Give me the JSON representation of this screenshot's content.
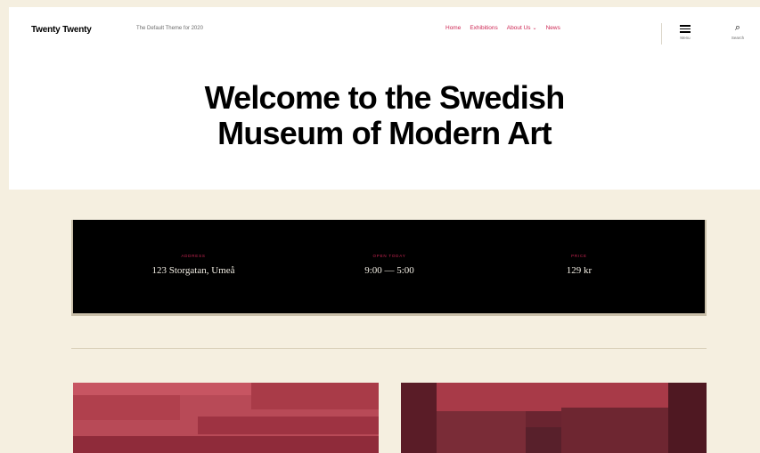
{
  "header": {
    "site_title": "Twenty Twenty",
    "site_description": "The Default Theme for 2020",
    "nav": [
      {
        "label": "Home"
      },
      {
        "label": "Exhibitions"
      },
      {
        "label": "About Us",
        "has_submenu": true
      },
      {
        "label": "News"
      }
    ],
    "menu_label": "Menu",
    "search_label": "Search",
    "menu_icon": "hamburger-icon",
    "search_icon": "search-icon"
  },
  "hero": {
    "line1": "Welcome to the Swedish",
    "line2": "Museum of Modern Art"
  },
  "info": [
    {
      "key": "Address",
      "value": "123 Storgatan, Umeå"
    },
    {
      "key": "Open Today",
      "value": "9:00 — 5:00"
    },
    {
      "key": "Price",
      "value": "129 kr"
    }
  ],
  "colors": {
    "accent": "#cd2653",
    "background": "#f5efe0",
    "header": "#ffffff",
    "info_bar": "#000000"
  }
}
